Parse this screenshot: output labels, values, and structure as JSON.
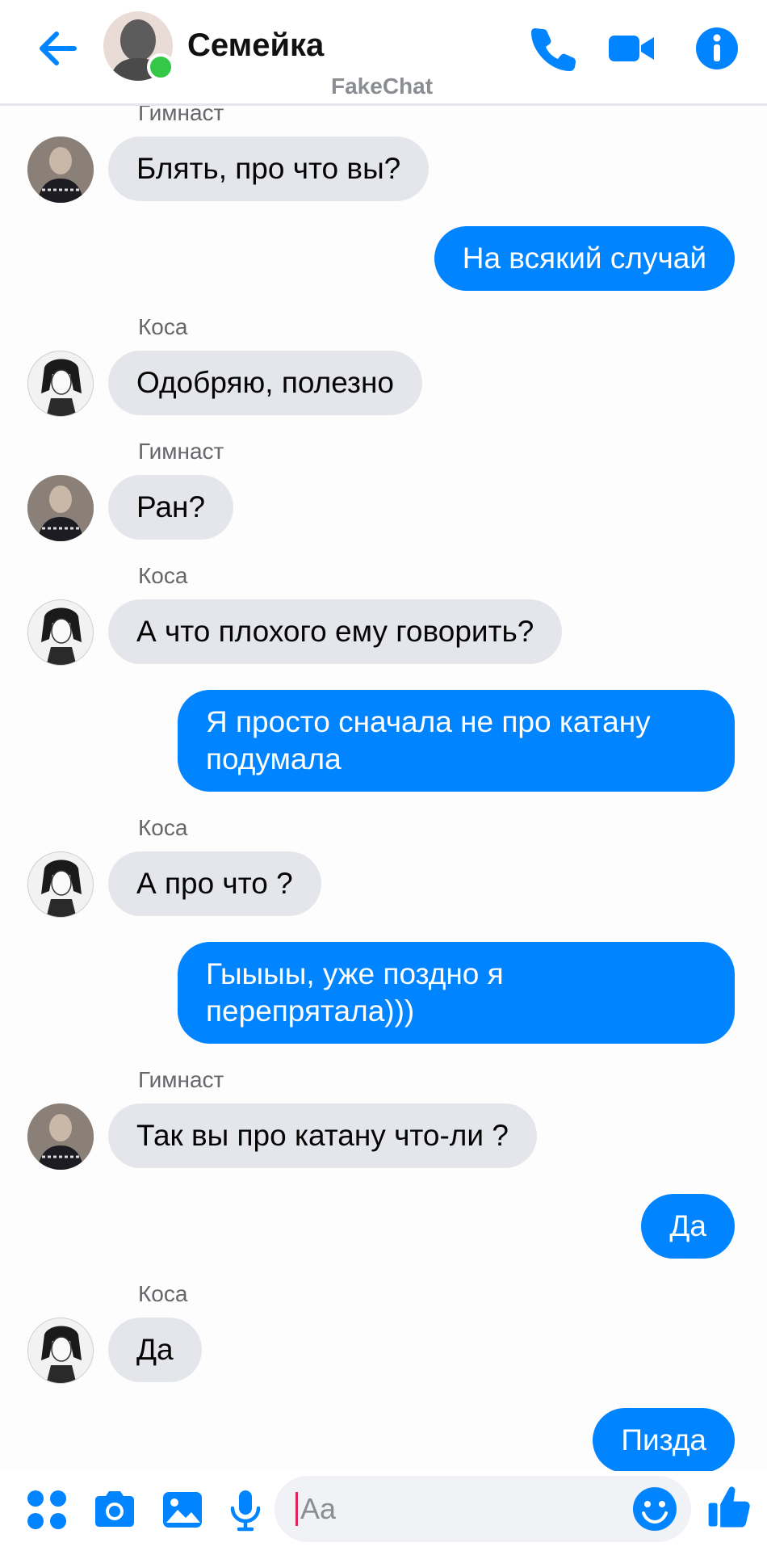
{
  "header": {
    "title": "Семейка",
    "watermark": "FakeChat",
    "accent_color": "#0084ff",
    "icons": [
      "back-arrow-icon",
      "phone-icon",
      "video-camera-icon",
      "info-icon"
    ]
  },
  "messages": [
    {
      "sender": "Гимнаст",
      "text": "Блять, про что вы?"
    },
    {
      "text": "На всякий случай"
    },
    {
      "sender": "Коса",
      "text": "Одобряю, полезно"
    },
    {
      "sender": "Гимнаст",
      "text": "Ран?"
    },
    {
      "sender": "Коса",
      "text": "А что плохого ему говорить?"
    },
    {
      "text": "Я просто сначала не про катану подумала"
    },
    {
      "sender": "Коса",
      "text": "А про что ?"
    },
    {
      "text": "Гыыыы, уже поздно я перепрятала)))"
    },
    {
      "sender": "Гимнаст",
      "text": "Так вы про катану что-ли ?"
    },
    {
      "text": "Да"
    },
    {
      "sender": "Коса",
      "text": "Да"
    },
    {
      "text": "Пизда"
    }
  ],
  "composer": {
    "placeholder": "Aa",
    "icons": [
      "apps-grid-icon",
      "camera-icon",
      "gallery-icon",
      "microphone-icon",
      "emoji-icon",
      "thumbs-up-icon"
    ]
  }
}
